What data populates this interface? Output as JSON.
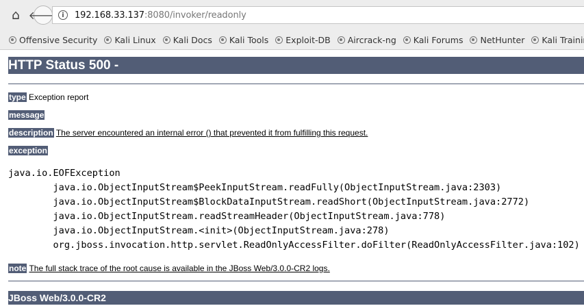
{
  "browser": {
    "url_host": "192.168.33.137",
    "url_rest": ":8080/invoker/readonly",
    "bookmarks": [
      "Offensive Security",
      "Kali Linux",
      "Kali Docs",
      "Kali Tools",
      "Exploit-DB",
      "Aircrack-ng",
      "Kali Forums",
      "NetHunter",
      "Kali Training"
    ]
  },
  "page": {
    "title": "HTTP Status 500 - ",
    "type_label": "type",
    "type_value": "Exception report",
    "message_label": "message",
    "description_label": "description",
    "description_value": "The server encountered an internal error () that prevented it from fulfilling this request.",
    "exception_label": "exception",
    "stack_trace": "java.io.EOFException\n\tjava.io.ObjectInputStream$PeekInputStream.readFully(ObjectInputStream.java:2303)\n\tjava.io.ObjectInputStream$BlockDataInputStream.readShort(ObjectInputStream.java:2772)\n\tjava.io.ObjectInputStream.readStreamHeader(ObjectInputStream.java:778)\n\tjava.io.ObjectInputStream.<init>(ObjectInputStream.java:278)\n\torg.jboss.invocation.http.servlet.ReadOnlyAccessFilter.doFilter(ReadOnlyAccessFilter.java:102)",
    "note_label": "note",
    "note_value": "The full stack trace of the root cause is available in the JBoss Web/3.0.0-CR2 logs.",
    "footer": "JBoss Web/3.0.0-CR2"
  }
}
